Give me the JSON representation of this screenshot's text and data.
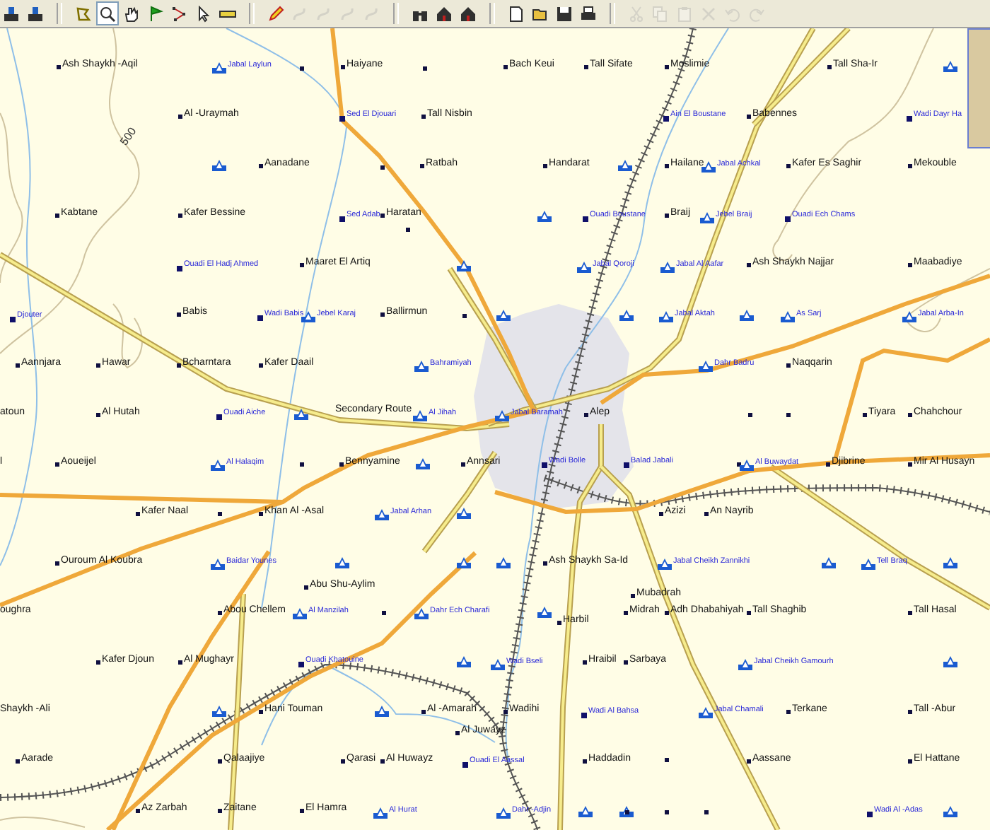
{
  "toolbar": {
    "buttons": [
      {
        "selected": false,
        "disabled": false
      },
      {
        "selected": false,
        "disabled": false
      },
      {
        "selected": false,
        "disabled": false
      },
      {
        "selected": true,
        "disabled": false
      },
      {
        "selected": false,
        "disabled": false
      },
      {
        "selected": false,
        "disabled": false
      },
      {
        "selected": false,
        "disabled": false
      },
      {
        "selected": false,
        "disabled": false
      },
      {
        "selected": false,
        "disabled": false
      },
      {
        "selected": false,
        "disabled": false
      },
      {
        "selected": false,
        "disabled": true
      },
      {
        "selected": false,
        "disabled": true
      },
      {
        "selected": false,
        "disabled": true
      },
      {
        "selected": false,
        "disabled": true
      },
      {
        "selected": false,
        "disabled": false
      },
      {
        "selected": false,
        "disabled": false
      },
      {
        "selected": false,
        "disabled": false
      },
      {
        "selected": false,
        "disabled": false
      },
      {
        "selected": false,
        "disabled": false
      },
      {
        "selected": false,
        "disabled": false
      },
      {
        "selected": false,
        "disabled": false
      },
      {
        "selected": false,
        "disabled": true
      },
      {
        "selected": false,
        "disabled": true
      },
      {
        "selected": false,
        "disabled": true
      },
      {
        "selected": false,
        "disabled": true
      },
      {
        "selected": false,
        "disabled": true
      },
      {
        "selected": false,
        "disabled": true
      }
    ]
  },
  "map": {
    "contour_label": "500",
    "places": [
      {
        "name": "Ash Shaykh -Aqil",
        "kind": "town"
      },
      {
        "name": "Haiyane",
        "kind": "town"
      },
      {
        "name": "Bach Keui",
        "kind": "town"
      },
      {
        "name": "Tall Sifate",
        "kind": "town"
      },
      {
        "name": "Moslimie",
        "kind": "town"
      },
      {
        "name": "Tall Sha-Ir",
        "kind": "town"
      },
      {
        "name": "Al -Uraymah",
        "kind": "town"
      },
      {
        "name": "Tall Nisbin",
        "kind": "town"
      },
      {
        "name": "Babennes",
        "kind": "town"
      },
      {
        "name": "Aanadane",
        "kind": "town"
      },
      {
        "name": "Ratbah",
        "kind": "town"
      },
      {
        "name": "Handarat",
        "kind": "town"
      },
      {
        "name": "Hailane",
        "kind": "town"
      },
      {
        "name": "Kafer Es Saghir",
        "kind": "town"
      },
      {
        "name": "Mekouble",
        "kind": "town"
      },
      {
        "name": "Kabtane",
        "kind": "town"
      },
      {
        "name": "Kafer Bessine",
        "kind": "town"
      },
      {
        "name": "Haratan",
        "kind": "town"
      },
      {
        "name": "Braij",
        "kind": "town"
      },
      {
        "name": "Maaret El Artiq",
        "kind": "town"
      },
      {
        "name": "Ash Shaykh Najjar",
        "kind": "town"
      },
      {
        "name": "Maabadiye",
        "kind": "town"
      },
      {
        "name": "Babis",
        "kind": "town"
      },
      {
        "name": "Ballirmun",
        "kind": "town"
      },
      {
        "name": "Aannjara",
        "kind": "town"
      },
      {
        "name": "Hawar",
        "kind": "town"
      },
      {
        "name": "Bcharntara",
        "kind": "town"
      },
      {
        "name": "Kafer Daail",
        "kind": "town"
      },
      {
        "name": "Naqqarin",
        "kind": "town"
      },
      {
        "name": "atoun",
        "kind": "town"
      },
      {
        "name": "Al Hutah",
        "kind": "town"
      },
      {
        "name": "Secondary Route",
        "kind": "road"
      },
      {
        "name": "Alep",
        "kind": "town"
      },
      {
        "name": "Tiyara",
        "kind": "town"
      },
      {
        "name": "Chahchour",
        "kind": "town"
      },
      {
        "name": "l",
        "kind": "town"
      },
      {
        "name": "Aoueijel",
        "kind": "town"
      },
      {
        "name": "Bennyamine",
        "kind": "town"
      },
      {
        "name": "Annsari",
        "kind": "town"
      },
      {
        "name": "Djibrine",
        "kind": "town"
      },
      {
        "name": "Mir Al Husayn",
        "kind": "town"
      },
      {
        "name": "Kafer Naal",
        "kind": "town"
      },
      {
        "name": "Khan Al -Asal",
        "kind": "town"
      },
      {
        "name": "Azizi",
        "kind": "town"
      },
      {
        "name": "An Nayrib",
        "kind": "town"
      },
      {
        "name": "Ouroum Al Koubra",
        "kind": "town"
      },
      {
        "name": "Ash Shaykh Sa-Id",
        "kind": "town"
      },
      {
        "name": "Abu Shu-Aylim",
        "kind": "town"
      },
      {
        "name": "oughra",
        "kind": "town"
      },
      {
        "name": "Abou Chellem",
        "kind": "town"
      },
      {
        "name": "Mubadrah",
        "kind": "town"
      },
      {
        "name": "Midrah",
        "kind": "town"
      },
      {
        "name": "Adh Dhabahiyah",
        "kind": "town"
      },
      {
        "name": "Tall Shaghib",
        "kind": "town"
      },
      {
        "name": "Tall Hasal",
        "kind": "town"
      },
      {
        "name": "Harbil",
        "kind": "town"
      },
      {
        "name": "Kafer Djoun",
        "kind": "town"
      },
      {
        "name": "Al Mughayr",
        "kind": "town"
      },
      {
        "name": "Hraibil",
        "kind": "town"
      },
      {
        "name": "Sarbaya",
        "kind": "town"
      },
      {
        "name": "Shaykh -Ali",
        "kind": "town"
      },
      {
        "name": "Hani Touman",
        "kind": "town"
      },
      {
        "name": "Al -Amarah",
        "kind": "town"
      },
      {
        "name": "Wadihi",
        "kind": "town"
      },
      {
        "name": "Terkane",
        "kind": "town"
      },
      {
        "name": "Tall -Abur",
        "kind": "town"
      },
      {
        "name": "Al Juwayz",
        "kind": "town"
      },
      {
        "name": "Aarade",
        "kind": "town"
      },
      {
        "name": "Qalaajiye",
        "kind": "town"
      },
      {
        "name": "Qarasi",
        "kind": "town"
      },
      {
        "name": "Al Huwayz",
        "kind": "town"
      },
      {
        "name": "Haddadin",
        "kind": "town"
      },
      {
        "name": "Aassane",
        "kind": "town"
      },
      {
        "name": "El Hattane",
        "kind": "town"
      },
      {
        "name": "Az Zarbah",
        "kind": "town"
      },
      {
        "name": "Zaitane",
        "kind": "town"
      },
      {
        "name": "El Hamra",
        "kind": "town"
      },
      {
        "name": "Jabal Laylun",
        "kind": "peak"
      },
      {
        "name": "Sed El Djouari",
        "kind": "site"
      },
      {
        "name": "Ain El Boustane",
        "kind": "site"
      },
      {
        "name": "Wadi Dayr Ha",
        "kind": "site"
      },
      {
        "name": "Jabal Achkal",
        "kind": "peak"
      },
      {
        "name": "Sed Adab",
        "kind": "site"
      },
      {
        "name": "Ouadi Boustane",
        "kind": "site"
      },
      {
        "name": "Jebel Braij",
        "kind": "peak"
      },
      {
        "name": "Ouadi Ech Chams",
        "kind": "site"
      },
      {
        "name": "Ouadi El Hadj Ahmed",
        "kind": "site"
      },
      {
        "name": "Jabal Qoroji",
        "kind": "peak"
      },
      {
        "name": "Jabal Al Aafar",
        "kind": "peak"
      },
      {
        "name": "Djouter",
        "kind": "site"
      },
      {
        "name": "Wadi Babis",
        "kind": "site"
      },
      {
        "name": "Jebel Karaj",
        "kind": "peak"
      },
      {
        "name": "Jabal Aktah",
        "kind": "peak"
      },
      {
        "name": "As Sarj",
        "kind": "peak"
      },
      {
        "name": "Jabal Arba-In",
        "kind": "peak"
      },
      {
        "name": "Bahramiyah",
        "kind": "peak"
      },
      {
        "name": "Dahr Badru",
        "kind": "peak"
      },
      {
        "name": "Ouadi Aiche",
        "kind": "site"
      },
      {
        "name": "Al Jihah",
        "kind": "peak"
      },
      {
        "name": "Jabal Baramah",
        "kind": "peak"
      },
      {
        "name": "Al Halaqim",
        "kind": "peak"
      },
      {
        "name": "Wadi Bolle",
        "kind": "site"
      },
      {
        "name": "Balad Jabali",
        "kind": "site"
      },
      {
        "name": "Al Buwaydat",
        "kind": "peak"
      },
      {
        "name": "Jabal Arhan",
        "kind": "peak"
      },
      {
        "name": "Baidar Younes",
        "kind": "peak"
      },
      {
        "name": "Jabal Cheikh Zannikhi",
        "kind": "peak"
      },
      {
        "name": "Tell Braq",
        "kind": "peak"
      },
      {
        "name": "Al Manzilah",
        "kind": "peak"
      },
      {
        "name": "Dahr Ech Charafi",
        "kind": "peak"
      },
      {
        "name": "Ouadi Khatouine",
        "kind": "site"
      },
      {
        "name": "Wadi Bseli",
        "kind": "peak"
      },
      {
        "name": "Jabal Cheikh Gamourh",
        "kind": "peak"
      },
      {
        "name": "Wadi Al Bahsa",
        "kind": "site"
      },
      {
        "name": "Jabal Chamali",
        "kind": "peak"
      },
      {
        "name": "Ouadi El Aassal",
        "kind": "site"
      },
      {
        "name": "Al Hurat",
        "kind": "peak"
      },
      {
        "name": "Dahr -Adjin",
        "kind": "peak"
      },
      {
        "name": "Wadi Al -Adas",
        "kind": "site"
      }
    ]
  }
}
